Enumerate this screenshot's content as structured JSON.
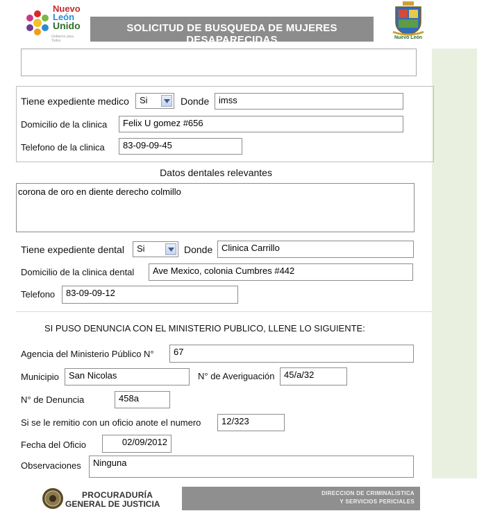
{
  "header": {
    "logo_text_line1": "Nuevo",
    "logo_text_line2": "León",
    "logo_text_line3": "Unido",
    "logo_tagline": "Gobierno para Todos",
    "title": "SOLICITUD DE BUSQUEDA DE MUJERES DESAPARECIDAS",
    "seal_caption": "Nuevo León"
  },
  "medical": {
    "has_record_label": "Tiene expediente medico",
    "has_record_value": "Si",
    "where_label": "Donde",
    "where_value": "imss",
    "clinic_address_label": "Domicilio de la clinica",
    "clinic_address_value": "Felix U gomez #656",
    "clinic_phone_label": "Telefono de la clinica",
    "clinic_phone_value": "83-09-09-45"
  },
  "dental": {
    "section_title": "Datos dentales relevantes",
    "notes_value": "corona de oro en diente derecho colmillo",
    "has_record_label": "Tiene expediente dental",
    "has_record_value": "Si",
    "where_label": "Donde",
    "where_value": "Clinica Carrillo",
    "clinic_address_label": "Domicilio de la clinica dental",
    "clinic_address_value": "Ave Mexico, colonia Cumbres #442",
    "phone_label": "Telefono",
    "phone_value": "83-09-09-12"
  },
  "complaint": {
    "heading": "SI PUSO DENUNCIA CON EL MINISTERIO PUBLICO, LLENE LO SIGUIENTE:",
    "agency_label": "Agencia del Ministerio Público N°",
    "agency_value": "67",
    "municipality_label": "Municipio",
    "municipality_value": "San Nicolas",
    "inquiry_label": "N° de Averiguación",
    "inquiry_value": "45/a/32",
    "complaint_no_label": "N° de Denuncia",
    "complaint_no_value": "458a",
    "official_letter_label": "Si se le remitio con un oficio anote el numero",
    "official_letter_value": "12/323",
    "letter_date_label": "Fecha del Oficio",
    "letter_date_value": "02/09/2012",
    "observations_label": "Observaciones",
    "observations_value": "Ninguna"
  },
  "footer": {
    "left_line1": "PROCURADURÍA",
    "left_line2": "GENERAL DE JUSTICIA",
    "right_line1": "DIRECCION DE CRIMINALISTICA",
    "right_line2": "Y SERVICIOS PERICIALES"
  },
  "colors": {
    "title_bar": "#8c8c8c",
    "side_panel": "#e9f0e0",
    "footer_bar": "#8f8f8f"
  }
}
